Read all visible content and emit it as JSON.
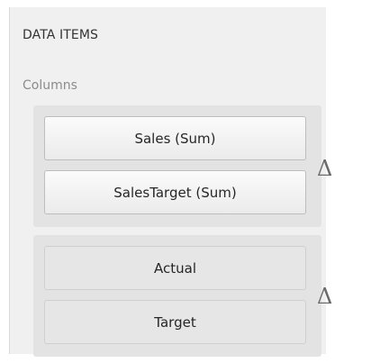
{
  "section_title": "DATA ITEMS",
  "columns_label": "Columns",
  "groups": [
    {
      "items": [
        {
          "label": "Sales (Sum)"
        },
        {
          "label": "SalesTarget (Sum)"
        }
      ],
      "icon": "delta-icon",
      "icon_glyph": "Δ"
    },
    {
      "items": [
        {
          "label": "Actual"
        },
        {
          "label": "Target"
        }
      ],
      "icon": "delta-icon",
      "icon_glyph": "Δ"
    }
  ]
}
